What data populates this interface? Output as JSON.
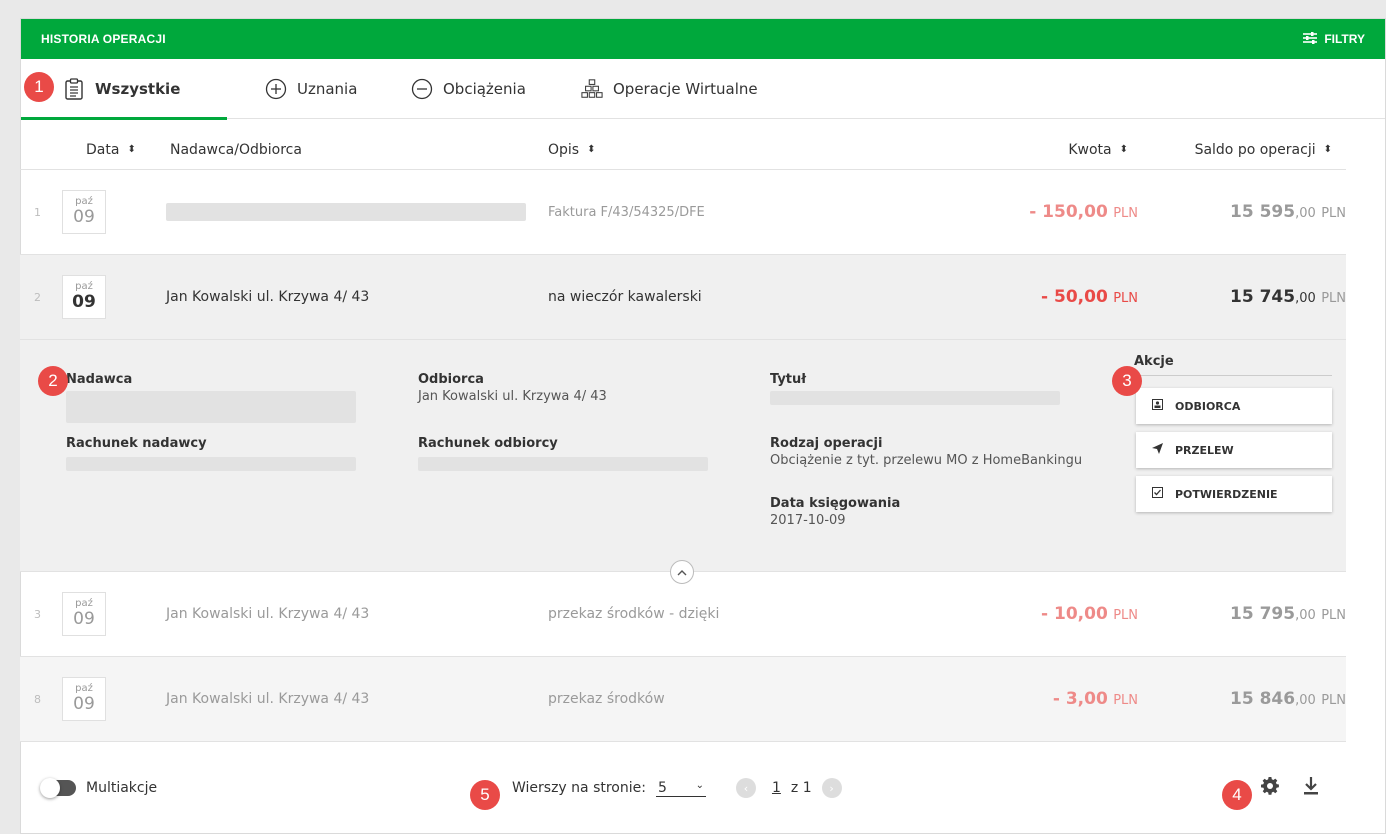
{
  "header": {
    "title": "HISTORIA OPERACJI",
    "filters_label": "FILTRY"
  },
  "markers": [
    "1",
    "2",
    "3",
    "4",
    "5"
  ],
  "tabs": [
    {
      "label": "Wszystkie",
      "icon": "clipboard-icon",
      "active": true
    },
    {
      "label": "Uznania",
      "icon": "plus-circle-icon"
    },
    {
      "label": "Obciążenia",
      "icon": "minus-circle-icon"
    },
    {
      "label": "Operacje Wirtualne",
      "icon": "pyramid-icon"
    }
  ],
  "columns": {
    "date": "Data",
    "party": "Nadawca/Odbiorca",
    "desc": "Opis",
    "amount": "Kwota",
    "saldo": "Saldo po operacji"
  },
  "rows": [
    {
      "idx": "1",
      "month": "paź",
      "day": "09",
      "party": "",
      "desc": "Faktura F/43/54325/DFE",
      "amount": "- 150,00",
      "amount_cur": "PLN",
      "saldo_int": "15 595",
      "saldo_dec": ",00",
      "saldo_cur": "PLN"
    },
    {
      "idx": "2",
      "month": "paź",
      "day": "09",
      "party": "Jan Kowalski ul. Krzywa 4/ 43",
      "desc": "na wieczór kawalerski",
      "amount": "- 50,00",
      "amount_cur": "PLN",
      "saldo_int": "15 745",
      "saldo_dec": ",00",
      "saldo_cur": "PLN"
    },
    {
      "idx": "3",
      "month": "paź",
      "day": "09",
      "party": "Jan Kowalski ul. Krzywa 4/ 43",
      "desc": "przekaz środków - dzięki",
      "amount": "- 10,00",
      "amount_cur": "PLN",
      "saldo_int": "15 795",
      "saldo_dec": ",00",
      "saldo_cur": "PLN"
    },
    {
      "idx": "8",
      "month": "paź",
      "day": "09",
      "party": "Jan Kowalski ul. Krzywa 4/ 43",
      "desc": "przekaz środków",
      "amount": "- 3,00",
      "amount_cur": "PLN",
      "saldo_int": "15 846",
      "saldo_dec": ",00",
      "saldo_cur": "PLN"
    }
  ],
  "details": {
    "sender_label": "Nadawca",
    "sender_account_label": "Rachunek nadawcy",
    "recipient_label": "Odbiorca",
    "recipient_value": "Jan Kowalski ul. Krzywa 4/ 43",
    "recipient_account_label": "Rachunek odbiorcy",
    "title_label": "Tytuł",
    "op_type_label": "Rodzaj operacji",
    "op_type_value": "Obciążenie z tyt. przelewu MO z HomeBankingu",
    "booking_date_label": "Data księgowania",
    "booking_date_value": "2017-10-09",
    "actions_title": "Akcje",
    "actions": [
      {
        "label": "ODBIORCA",
        "icon": "contact-card-icon"
      },
      {
        "label": "PRZELEW",
        "icon": "send-icon"
      },
      {
        "label": "POTWIERDZENIE",
        "icon": "checkbox-icon"
      }
    ]
  },
  "footer": {
    "multi_label": "Multiakcje",
    "rows_per_page_label": "Wierszy na stronie:",
    "rows_per_page_value": "5",
    "page_current": "1",
    "page_of": "z 1"
  },
  "colors": {
    "brand": "#00a83c",
    "negative": "#e94a47",
    "marker": "#e94a47"
  }
}
